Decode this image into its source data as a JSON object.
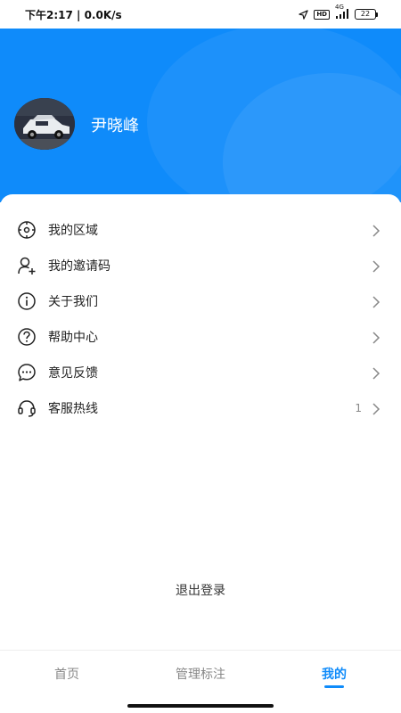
{
  "status_bar": {
    "left_text": "下午2:17 | 0.0K/s",
    "hd": "HD",
    "network": "4G",
    "battery": "22"
  },
  "profile": {
    "name": "尹晓峰"
  },
  "menu": [
    {
      "label": "我的区域",
      "icon": "target-icon",
      "extra": ""
    },
    {
      "label": "我的邀请码",
      "icon": "user-add-icon",
      "extra": ""
    },
    {
      "label": "关于我们",
      "icon": "info-icon",
      "extra": ""
    },
    {
      "label": "帮助中心",
      "icon": "help-icon",
      "extra": ""
    },
    {
      "label": "意见反馈",
      "icon": "chat-bubble-icon",
      "extra": ""
    },
    {
      "label": "客服热线",
      "icon": "headset-icon",
      "extra": "1"
    }
  ],
  "logout_label": "退出登录",
  "tabs": [
    {
      "label": "首页",
      "active": false
    },
    {
      "label": "管理标注",
      "active": false
    },
    {
      "label": "我的",
      "active": true
    }
  ],
  "colors": {
    "primary": "#0f8bfa"
  }
}
